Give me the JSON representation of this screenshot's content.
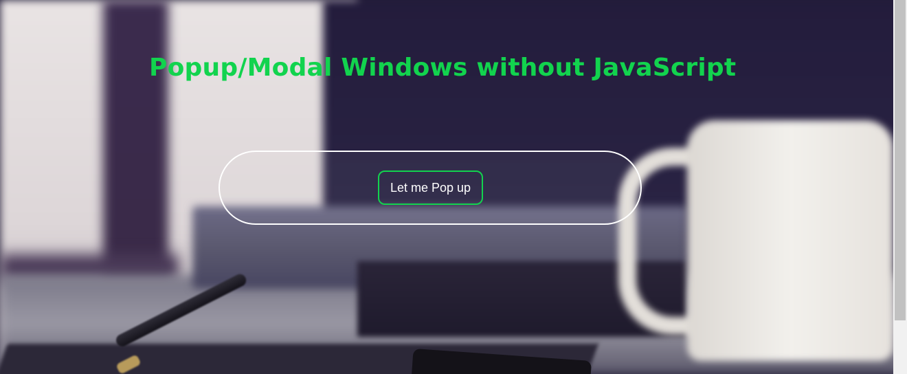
{
  "page": {
    "title": "Popup/Modal Windows without JavaScript",
    "title_color": "#12d34e",
    "accent_color": "#12d34e",
    "border_color": "#ffffff"
  },
  "popup_button": {
    "label": "Let me Pop up"
  },
  "icons": {
    "background": "desk-photo-background"
  }
}
